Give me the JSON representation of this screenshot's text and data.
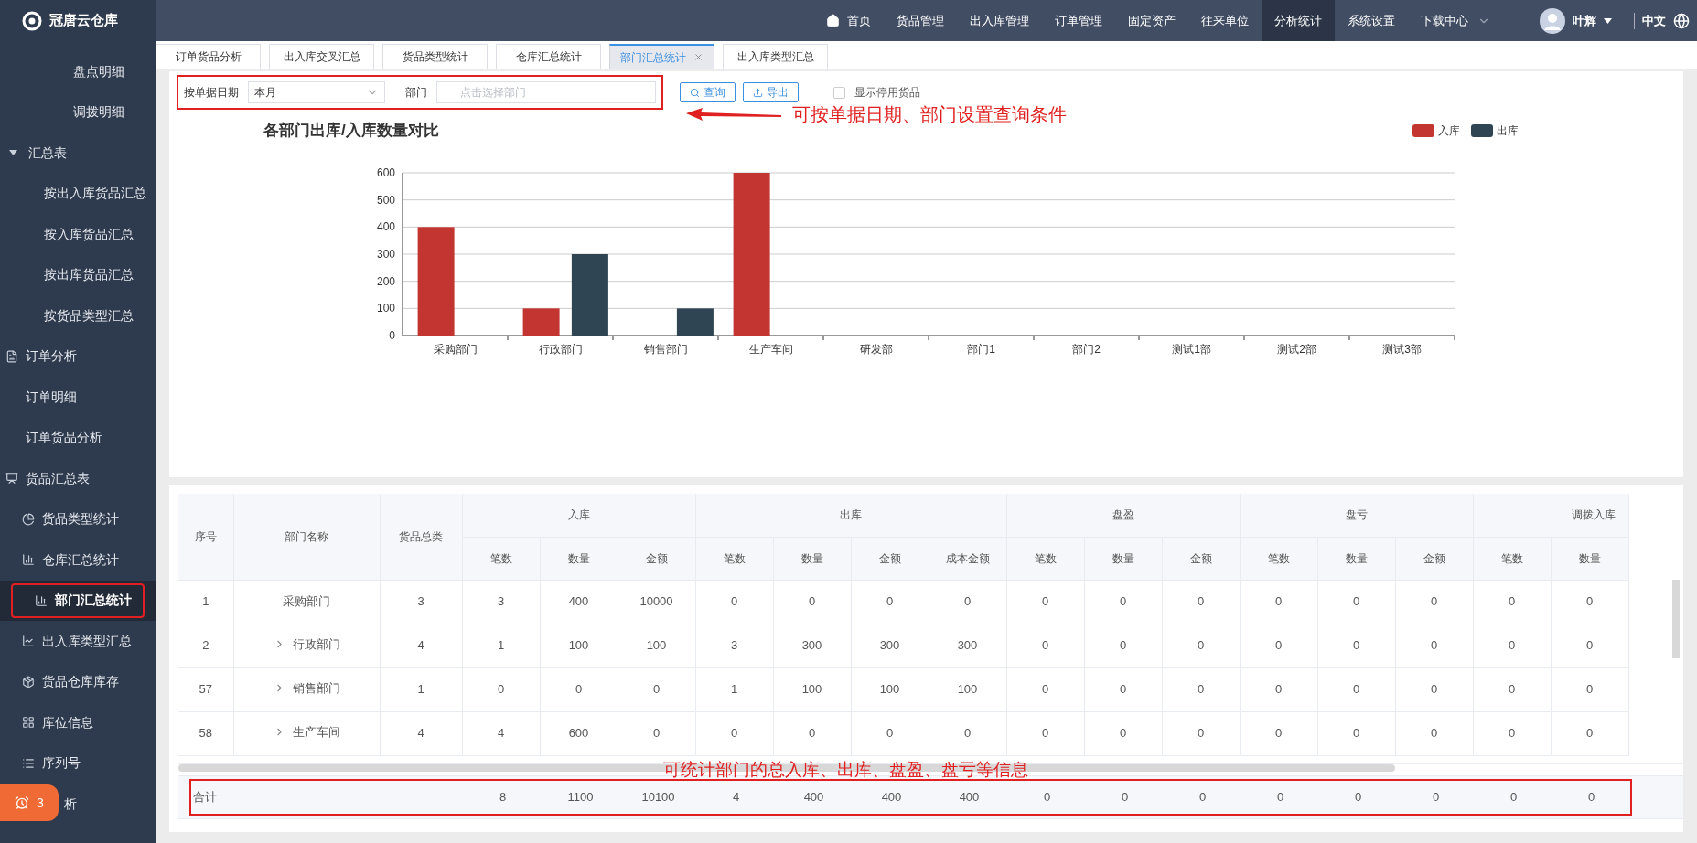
{
  "brand": {
    "name": "冠唐云仓库"
  },
  "nav": [
    {
      "label": "首页",
      "selected": false,
      "kind": "home"
    },
    {
      "label": "货品管理",
      "selected": false,
      "kind": "plain"
    },
    {
      "label": "出入库管理",
      "selected": false,
      "kind": "plain"
    },
    {
      "label": "订单管理",
      "selected": false,
      "kind": "plain"
    },
    {
      "label": "固定资产",
      "selected": false,
      "kind": "plain"
    },
    {
      "label": "往来单位",
      "selected": false,
      "kind": "plain"
    },
    {
      "label": "分析统计",
      "selected": true,
      "kind": "plain"
    },
    {
      "label": "系统设置",
      "selected": false,
      "kind": "plain"
    },
    {
      "label": "下载中心",
      "selected": false,
      "kind": "dropdown"
    }
  ],
  "user": {
    "name": "叶辉"
  },
  "language": "中文",
  "sidebar": {
    "items": [
      {
        "label": "盘点明细",
        "kind": "leaf",
        "selected": false
      },
      {
        "label": "调拨明细",
        "kind": "leaf",
        "selected": false
      },
      {
        "label": "汇总表",
        "kind": "group",
        "selected": false,
        "expanded": true,
        "children": [
          {
            "label": "按出入库货品汇总",
            "selected": false
          },
          {
            "label": "按入库货品汇总",
            "selected": false
          },
          {
            "label": "按出库货品汇总",
            "selected": false
          },
          {
            "label": "按货品类型汇总",
            "selected": false
          }
        ]
      },
      {
        "label": "订单分析",
        "kind": "menu",
        "selected": false,
        "children": [
          {
            "label": "订单明细",
            "selected": false
          },
          {
            "label": "订单货品分析",
            "selected": false
          }
        ]
      },
      {
        "label": "货品汇总表",
        "kind": "menu",
        "selected": false,
        "children": [
          {
            "label": "货品类型统计",
            "selected": false
          },
          {
            "label": "仓库汇总统计",
            "selected": false
          },
          {
            "label": "部门汇总统计",
            "selected": true,
            "highlighted": true
          },
          {
            "label": "出入库类型汇总",
            "selected": false
          },
          {
            "label": "货品仓库库存",
            "selected": false
          },
          {
            "label": "库位信息",
            "selected": false
          },
          {
            "label": "序列号",
            "selected": false
          },
          {
            "label": "析",
            "selected": false
          }
        ]
      }
    ]
  },
  "alert_badge": {
    "count": "3"
  },
  "tabs": [
    {
      "label": "订单货品分析",
      "selected": false
    },
    {
      "label": "出入库交叉汇总",
      "selected": false
    },
    {
      "label": "货品类型统计",
      "selected": false
    },
    {
      "label": "仓库汇总统计",
      "selected": false
    },
    {
      "label": "部门汇总统计",
      "selected": true,
      "closable": true
    },
    {
      "label": "出入库类型汇总",
      "selected": false
    }
  ],
  "filter": {
    "highlighted": true,
    "date_label": "按单据日期",
    "date_value": "本月",
    "dept_label": "部门",
    "dept_placeholder": "点击选择部门",
    "query_button": "查询",
    "export_button": "导出",
    "show_disabled": {
      "label": "显示停用货品",
      "checked": false
    }
  },
  "filter_annotation": "可按单据日期、部门设置查询条件",
  "chart": {
    "chart_data": {
      "type": "bar",
      "title": "各部门出库/入库数量对比",
      "categories": [
        "采购部门",
        "行政部门",
        "销售部门",
        "生产车间",
        "研发部",
        "部门1",
        "部门2",
        "测试1部",
        "测试2部",
        "测试3部"
      ],
      "series": [
        {
          "name": "入库",
          "color": "#c23531",
          "values": [
            400,
            100,
            0,
            600,
            0,
            0,
            0,
            0,
            0,
            0
          ]
        },
        {
          "name": "出库",
          "color": "#2f4554",
          "values": [
            0,
            300,
            100,
            0,
            0,
            0,
            0,
            0,
            0,
            0
          ]
        }
      ],
      "ylim": [
        0,
        600
      ],
      "yticks": [
        0,
        100,
        200,
        300,
        400,
        500,
        600
      ],
      "grid": true,
      "legend": true
    }
  },
  "table": {
    "columns_fixed": [
      "序号",
      "部门名称",
      "货品总类"
    ],
    "groups": [
      {
        "label": "入库",
        "columns": [
          "笔数",
          "数量",
          "金额"
        ]
      },
      {
        "label": "出库",
        "columns": [
          "笔数",
          "数量",
          "金额",
          "成本金额"
        ]
      },
      {
        "label": "盘盈",
        "columns": [
          "笔数",
          "数量",
          "金额"
        ]
      },
      {
        "label": "盘亏",
        "columns": [
          "笔数",
          "数量",
          "金额"
        ]
      },
      {
        "label": "调拨入库",
        "columns": [
          "笔数",
          "数量"
        ]
      }
    ],
    "rows": [
      {
        "kind": "leaf",
        "cells": [
          "1",
          "采购部门",
          "3",
          "3",
          "400",
          "10000",
          "0",
          "0",
          "0",
          "0",
          "0",
          "0",
          "0",
          "0",
          "0",
          "0",
          "0",
          "0"
        ]
      },
      {
        "kind": "branch",
        "expanded": false,
        "cells": [
          "2",
          "行政部门",
          "4",
          "1",
          "100",
          "100",
          "3",
          "300",
          "300",
          "300",
          "0",
          "0",
          "0",
          "0",
          "0",
          "0",
          "0",
          "0"
        ]
      },
      {
        "kind": "branch",
        "expanded": false,
        "cells": [
          "57",
          "销售部门",
          "1",
          "0",
          "0",
          "0",
          "1",
          "100",
          "100",
          "100",
          "0",
          "0",
          "0",
          "0",
          "0",
          "0",
          "0",
          "0"
        ]
      },
      {
        "kind": "branch",
        "expanded": false,
        "cells": [
          "58",
          "生产车间",
          "4",
          "4",
          "600",
          "0",
          "0",
          "0",
          "0",
          "0",
          "0",
          "0",
          "0",
          "0",
          "0",
          "0",
          "0",
          "0"
        ]
      }
    ],
    "total": {
      "highlighted": true,
      "cells": [
        "合计",
        "",
        "",
        "8",
        "1100",
        "10100",
        "4",
        "400",
        "400",
        "400",
        "0",
        "0",
        "0",
        "0",
        "0",
        "0",
        "0",
        "0"
      ]
    },
    "annotation": "可统计部门的总入库、出库、盘盈、盘亏等信息"
  }
}
